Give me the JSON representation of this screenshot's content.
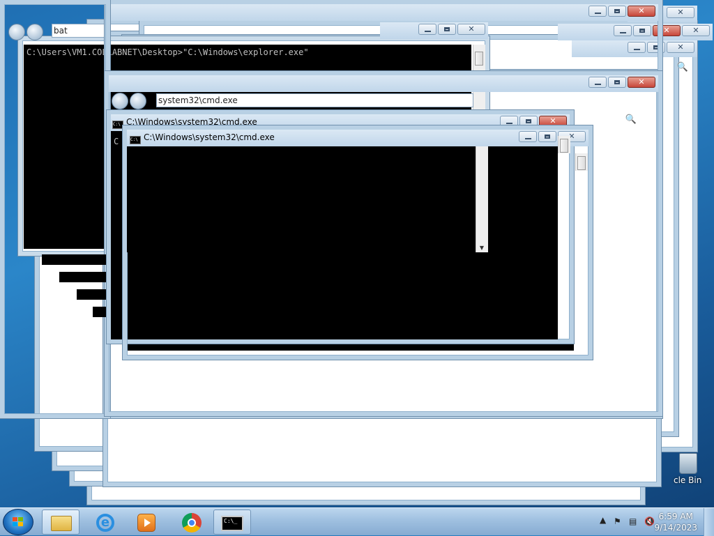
{
  "console_main": {
    "prompt_line": "C:\\Users\\VM1.COLLABNET\\Desktop>\"C:\\Windows\\explorer.exe\""
  },
  "explorer_addr_top": "bat",
  "explorer_addr_mid": "system32\\cmd.exe",
  "cmd_windows": [
    {
      "title": "C:\\Windows\\system32\\cmd.exe"
    },
    {
      "title": "C:\\Windows\\system32\\cmd.exe"
    }
  ],
  "console_peek": "C",
  "desktop_icon": {
    "label": "cle Bin",
    "icon": "recycle-bin-icon"
  },
  "taskbar": {
    "items": [
      {
        "name": "windows-explorer",
        "icon": "folder-icon"
      },
      {
        "name": "internet-explorer",
        "icon": "ie-icon"
      },
      {
        "name": "media-player",
        "icon": "media-player-icon"
      },
      {
        "name": "chrome",
        "icon": "chrome-icon"
      },
      {
        "name": "cmd",
        "icon": "cmd-icon",
        "glyph": "C:\\_"
      }
    ],
    "clock_time": "6:59 AM",
    "clock_date": "9/14/2023"
  },
  "colors": {
    "window_frame": "#b8d0e4",
    "console_bg": "#000000",
    "close_red": "#c7463a"
  }
}
